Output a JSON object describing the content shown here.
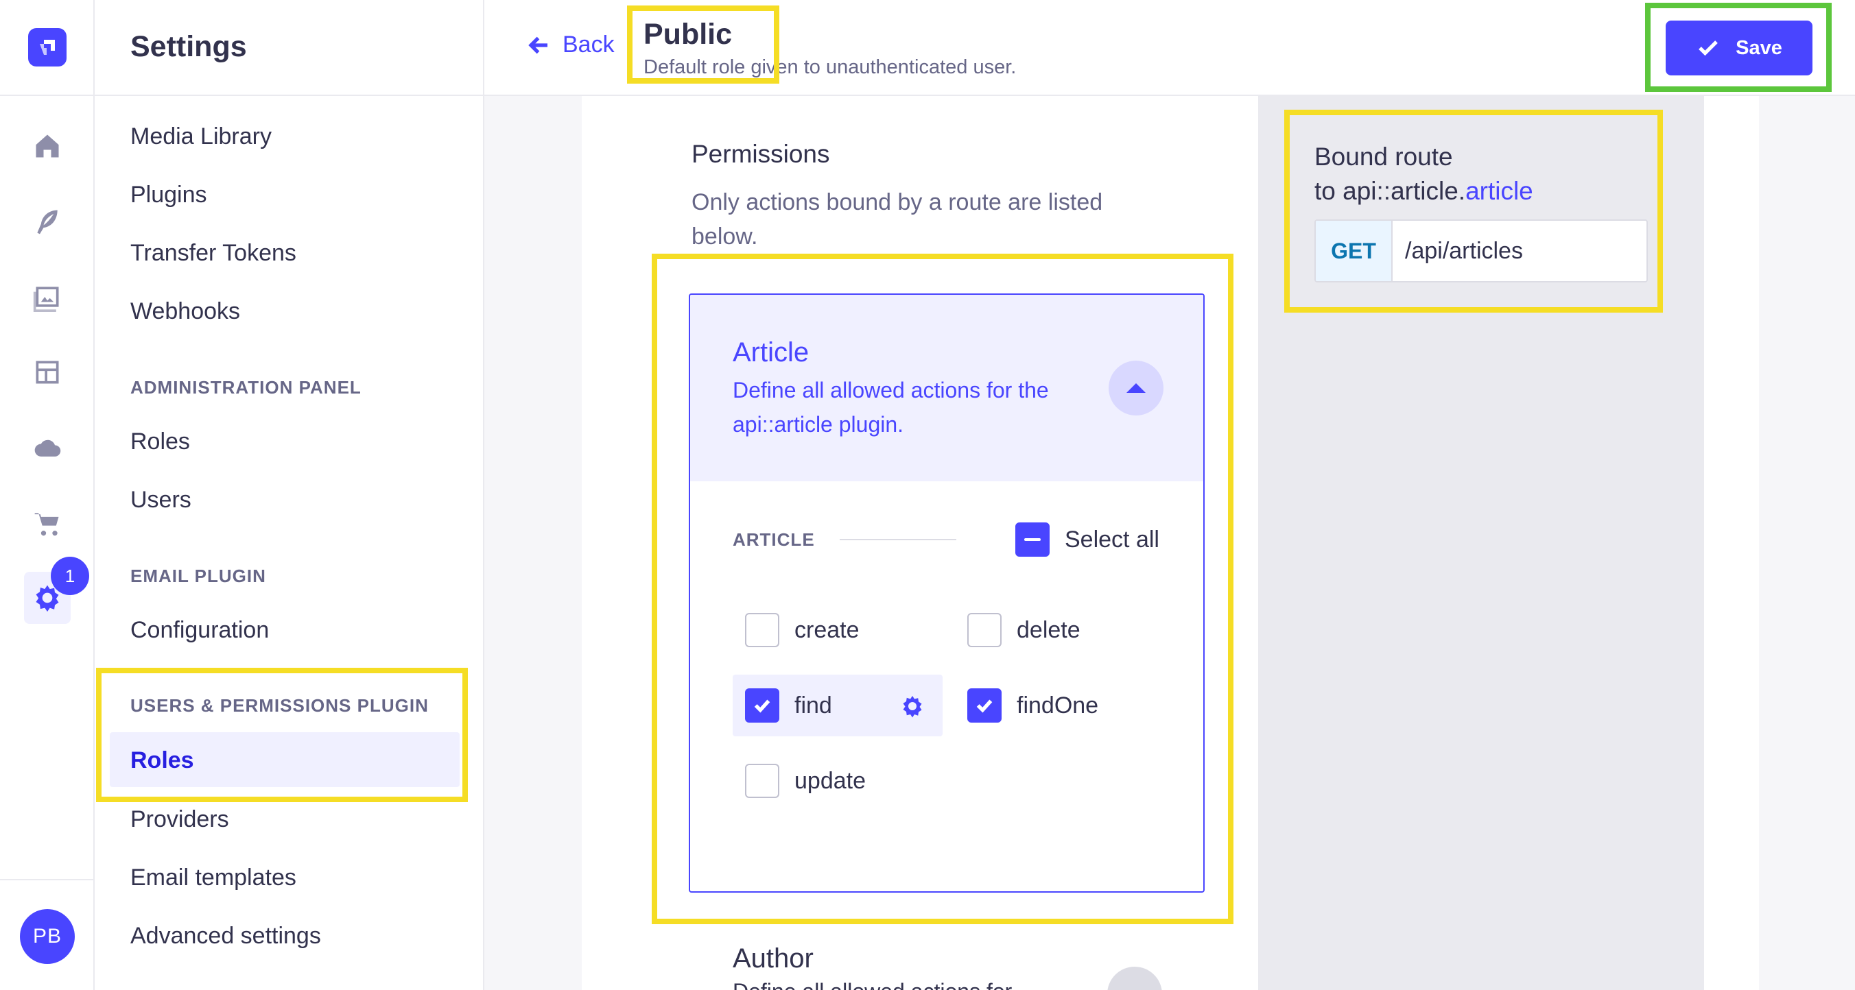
{
  "rail": {
    "items": [
      "home-icon",
      "feather-icon",
      "image-icon",
      "layout-icon",
      "cloud-icon",
      "cart-icon",
      "gear-icon"
    ],
    "settings_badge": "1",
    "avatar_initials": "PB"
  },
  "subnav": {
    "title": "Settings",
    "items_top": [
      "Media Library",
      "Plugins",
      "Transfer Tokens",
      "Webhooks"
    ],
    "section_admin": "ADMINISTRATION PANEL",
    "items_admin": [
      "Roles",
      "Users"
    ],
    "section_email": "EMAIL PLUGIN",
    "items_email": [
      "Configuration"
    ],
    "section_up": "USERS & PERMISSIONS PLUGIN",
    "items_up": [
      "Roles",
      "Providers",
      "Email templates",
      "Advanced settings"
    ]
  },
  "header": {
    "back_label": "Back",
    "title": "Public",
    "subtitle": "Default role given to unauthenticated user.",
    "save_label": "Save"
  },
  "permissions": {
    "title": "Permissions",
    "description": "Only actions bound by a route are listed below.",
    "accordion": {
      "title": "Article",
      "description": "Define all allowed actions for the api::article plugin.",
      "group_label": "ARTICLE",
      "select_all_label": "Select all",
      "select_all_state": "indeterminate",
      "actions": [
        {
          "label": "create",
          "checked": false
        },
        {
          "label": "delete",
          "checked": false
        },
        {
          "label": "find",
          "checked": true
        },
        {
          "label": "findOne",
          "checked": true
        },
        {
          "label": "update",
          "checked": false
        }
      ]
    },
    "next_accordion": {
      "title": "Author",
      "description": "Define all allowed actions for"
    }
  },
  "route": {
    "title_line1": "Bound route",
    "title_prefix": "to api::article.",
    "title_accent": "article",
    "method": "GET",
    "path": "/api/articles"
  },
  "colors": {
    "primary": "#4945ff",
    "highlight_yellow": "#f5dd25",
    "highlight_green": "#5cc63c"
  }
}
